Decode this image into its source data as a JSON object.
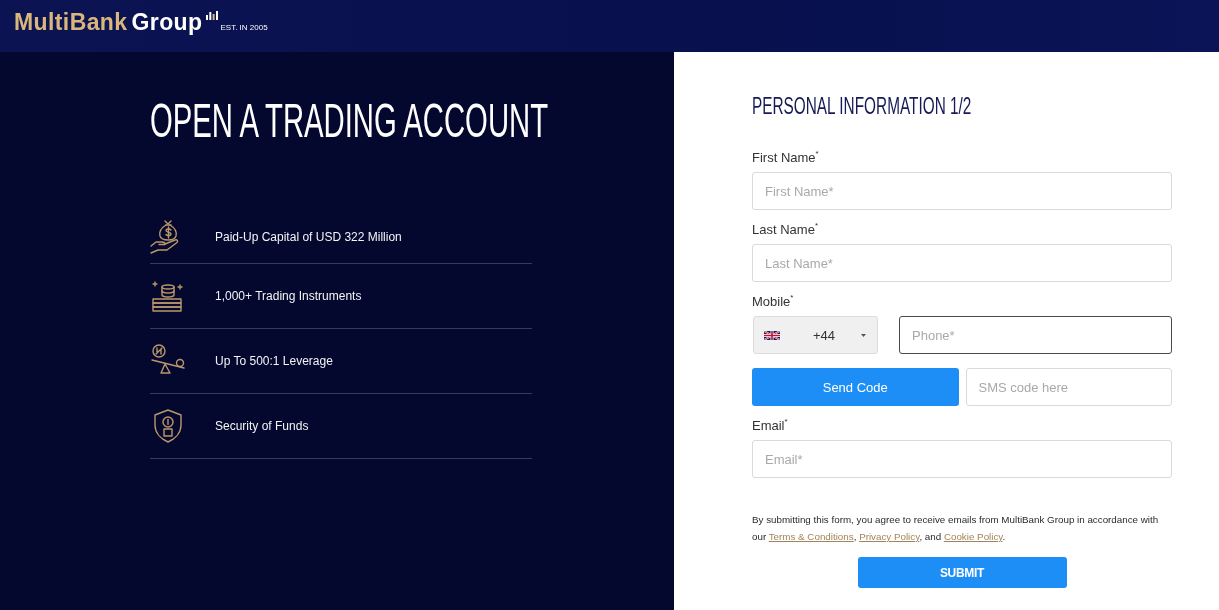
{
  "header": {
    "brand": "MultiBank",
    "brand_suffix": "Group",
    "tagline": "EST. IN 2005"
  },
  "hero": {
    "title": "OPEN A TRADING ACCOUNT",
    "features": [
      {
        "kind": "capital",
        "text": "Paid-Up Capital of USD 322 Million"
      },
      {
        "kind": "instruments",
        "text": "1,000+ Trading Instruments"
      },
      {
        "kind": "leverage",
        "text": "Up To 500:1 Leverage"
      },
      {
        "kind": "security",
        "text": "Security of Funds"
      }
    ]
  },
  "form": {
    "title": "PERSONAL INFORMATION 1/2",
    "fields": [
      {
        "kind": "text",
        "label": "First Name$^{*}$",
        "placeholder": "First Name*",
        "focused": false
      },
      {
        "kind": "text",
        "label": "Last Name$^{*}$",
        "placeholder": "Last Name*",
        "focused": false
      },
      {
        "kind": "phone",
        "label": "Mobile$^{*}$",
        "country_code": "+44",
        "placeholder": "Phone*",
        "focused": true
      },
      {
        "kind": "verify",
        "button": "Send Code",
        "placeholder": "SMS code here",
        "focused": false
      },
      {
        "kind": "text",
        "label": "Email$^{*}$",
        "placeholder": "Email*",
        "focused": false
      }
    ],
    "consent": [
      {
        "kind": "text",
        "text": "By submitting this form, you agree to receive emails from MultiBank Group in accordance with our "
      },
      {
        "kind": "link",
        "text": "Terms & Conditions"
      },
      {
        "kind": "text",
        "text": ", "
      },
      {
        "kind": "link",
        "text": "Privacy Policy"
      },
      {
        "kind": "text",
        "text": ", and "
      },
      {
        "kind": "link",
        "text": "Cookie Policy"
      },
      {
        "kind": "text",
        "text": "."
      }
    ],
    "submit": "SUBMIT"
  }
}
